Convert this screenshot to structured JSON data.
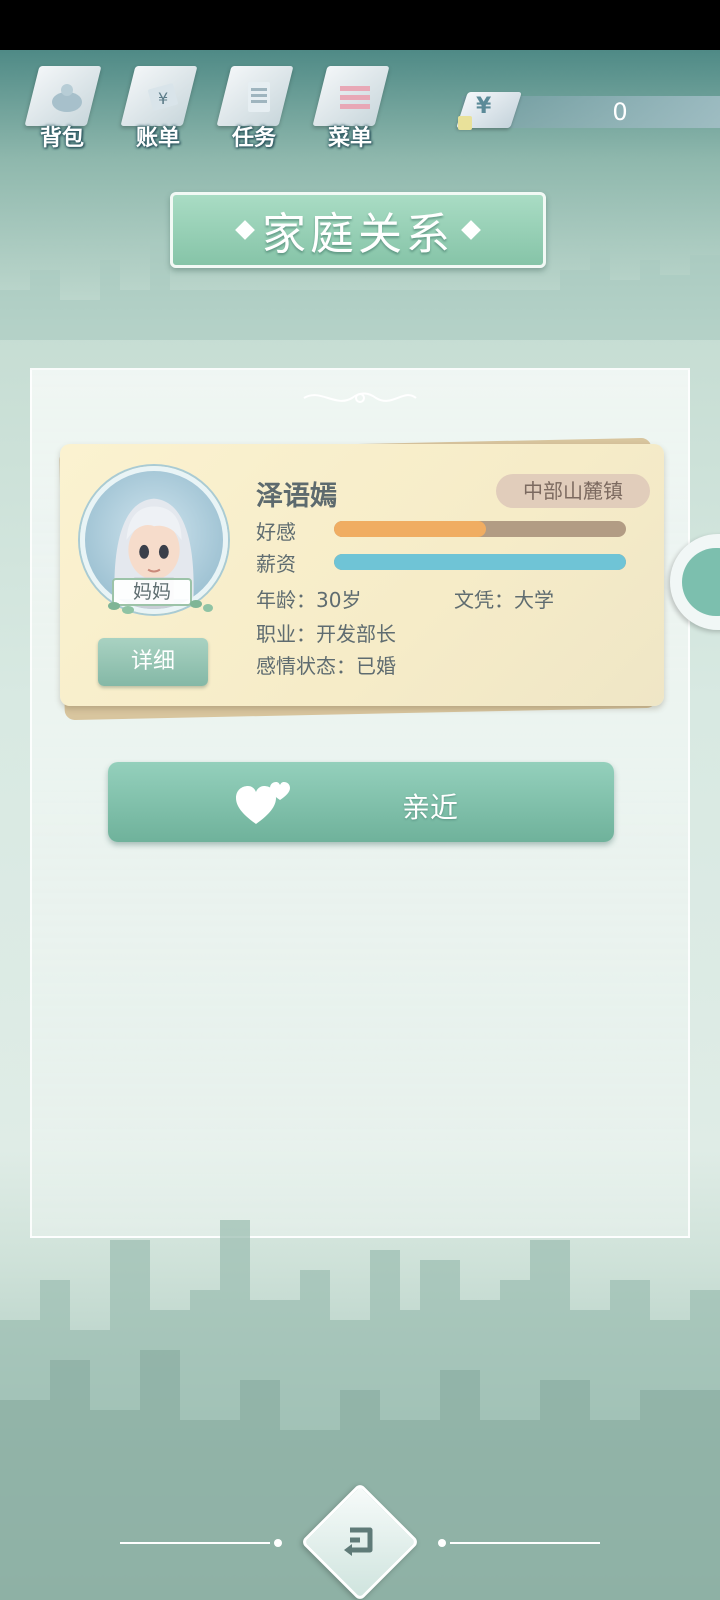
{
  "toolbar": {
    "items": [
      {
        "label": "背包",
        "icon": "bag-icon"
      },
      {
        "label": "账单",
        "icon": "bill-icon"
      },
      {
        "label": "任务",
        "icon": "task-list-icon"
      },
      {
        "label": "菜单",
        "icon": "menu-icon"
      }
    ]
  },
  "currency": {
    "symbol": "¥",
    "value": "0"
  },
  "page": {
    "title": "家庭关系"
  },
  "character": {
    "name": "泽语嫣",
    "location": "中部山麓镇",
    "relation": "妈妈",
    "detail_label": "详细",
    "affection_label": "好感",
    "affection_level": 0.52,
    "salary_label": "薪资",
    "salary_level": 1.0,
    "age_text": "年龄：30岁",
    "education_text": "文凭：大学",
    "job_text": "职业：开发部长",
    "marital_text": "感情状态：已婚"
  },
  "action": {
    "label": "亲近"
  },
  "colors": {
    "accent": "#86c4a8",
    "affection_fill": "#f0ad62",
    "salary_fill": "#6fc4d6",
    "bar_track": "#b29c84",
    "location_badge": "#e1cdbb"
  }
}
